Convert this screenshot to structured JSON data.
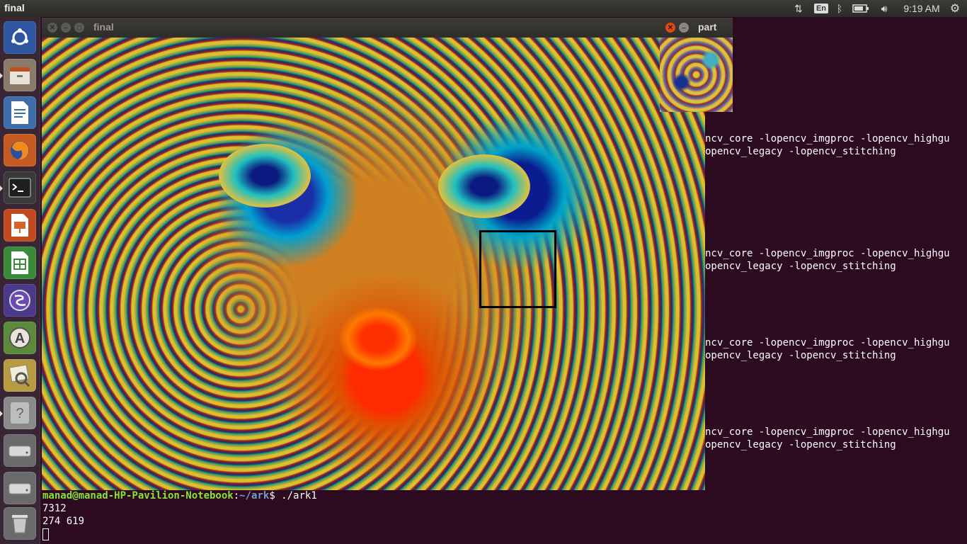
{
  "top_panel": {
    "app_title": "final",
    "keyboard_layout": "En",
    "clock": "9:19 AM",
    "icons": [
      "network-icon",
      "keyboard-icon",
      "bluetooth-icon",
      "battery-icon",
      "volume-icon",
      "gear-icon"
    ]
  },
  "launcher": {
    "items": [
      {
        "name": "ubuntu-dash-icon",
        "running": false
      },
      {
        "name": "files-icon",
        "running": true
      },
      {
        "name": "libreoffice-writer-icon",
        "running": false
      },
      {
        "name": "firefox-icon",
        "running": false
      },
      {
        "name": "terminal-icon",
        "running": true
      },
      {
        "name": "libreoffice-impress-icon",
        "running": false
      },
      {
        "name": "libreoffice-calc-icon",
        "running": false
      },
      {
        "name": "emacs-icon",
        "running": false
      },
      {
        "name": "software-center-icon",
        "running": false
      },
      {
        "name": "image-viewer-icon",
        "running": false
      },
      {
        "name": "unknown-app-icon",
        "running": true
      },
      {
        "name": "drive-icon",
        "running": false
      },
      {
        "name": "drive-icon",
        "running": false
      },
      {
        "name": "trash-icon",
        "running": false
      }
    ]
  },
  "windows": {
    "final": {
      "title": "final"
    },
    "part": {
      "title": "part"
    }
  },
  "terminal": {
    "compile_lines": [
      {
        "line1": "ncv_core -lopencv_imgproc -lopencv_highgu",
        "line2": "opencv_legacy -lopencv_stitching"
      },
      {
        "line1": "ncv_core -lopencv_imgproc -lopencv_highgu",
        "line2": "opencv_legacy -lopencv_stitching"
      },
      {
        "line1": "ncv_core -lopencv_imgproc -lopencv_highgu",
        "line2": "opencv_legacy -lopencv_stitching"
      },
      {
        "line1": "ncv_core -lopencv_imgproc -lopencv_highgu",
        "line2": "opencv_legacy -lopencv_stitching"
      }
    ],
    "prompt_user": "manad@manad-HP-Pavilion-Notebook",
    "prompt_path": "~/ark",
    "prompt_symbol": "$ ",
    "command": "./ark1",
    "output_line1": "7312",
    "output_line2": "274 619"
  },
  "colors": {
    "terminal_bg": "#2c0a1f",
    "prompt_user": "#8ae234",
    "prompt_path": "#729fcf",
    "close_button": "#df4a16"
  }
}
